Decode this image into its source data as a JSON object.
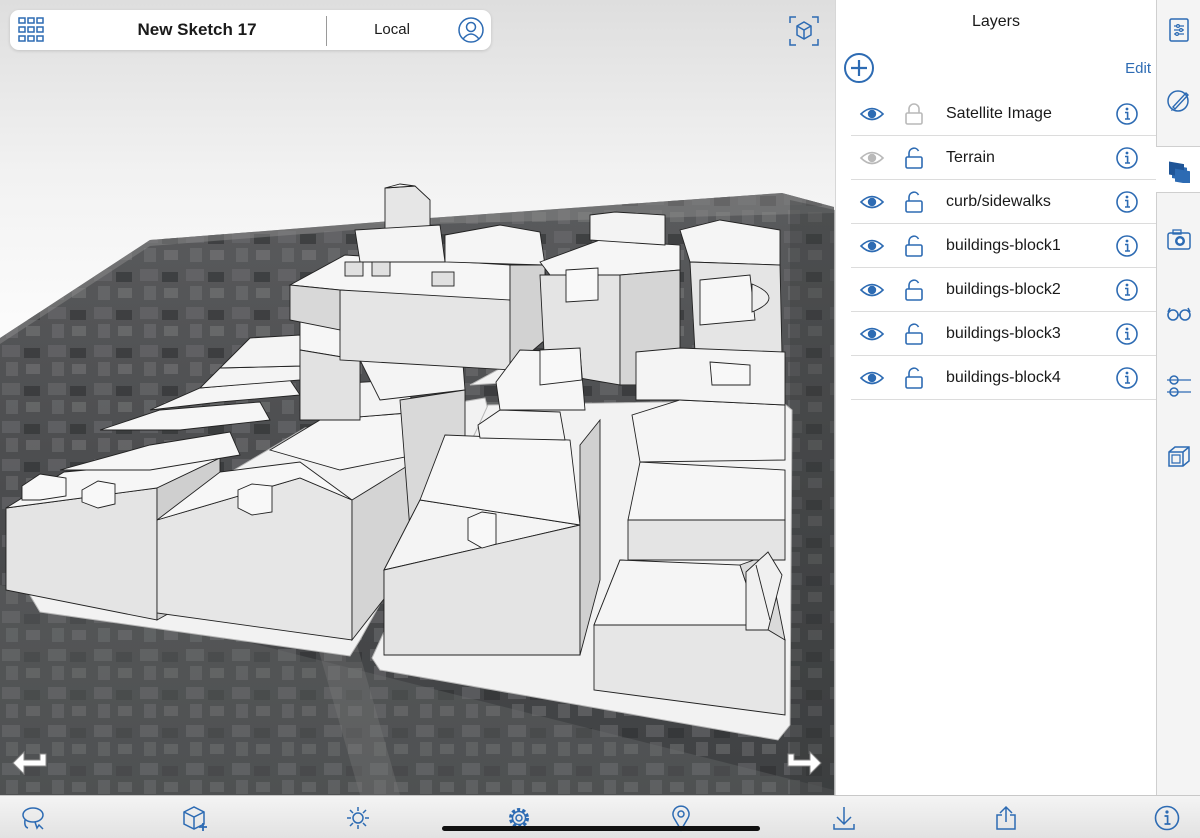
{
  "header": {
    "sketch_title": "New Sketch 17",
    "location_label": "Local"
  },
  "layers_panel": {
    "title": "Layers",
    "edit_label": "Edit",
    "layers": [
      {
        "name": "Satellite Image",
        "visible": true,
        "locked": true
      },
      {
        "name": "Terrain",
        "visible": false,
        "locked": false
      },
      {
        "name": "curb/sidewalks",
        "visible": true,
        "locked": false
      },
      {
        "name": "buildings-block1",
        "visible": true,
        "locked": false
      },
      {
        "name": "buildings-block2",
        "visible": true,
        "locked": false
      },
      {
        "name": "buildings-block3",
        "visible": true,
        "locked": false
      },
      {
        "name": "buildings-block4",
        "visible": true,
        "locked": false
      }
    ]
  },
  "side_tabs": [
    "entity-info-icon",
    "materials-icon",
    "layers-icon",
    "scenes-icon",
    "views-icon",
    "sections-icon",
    "components-icon"
  ],
  "toolbar_icons": [
    "select-icon",
    "add-component-icon",
    "shadows-icon",
    "settings-icon",
    "location-icon",
    "import-icon",
    "export-icon",
    "info-icon"
  ],
  "colors": {
    "accent": "#2d6bb3",
    "building": "#f3f3f3",
    "building_side": "#e2e2e2",
    "satellite": "#4a4c4f"
  }
}
